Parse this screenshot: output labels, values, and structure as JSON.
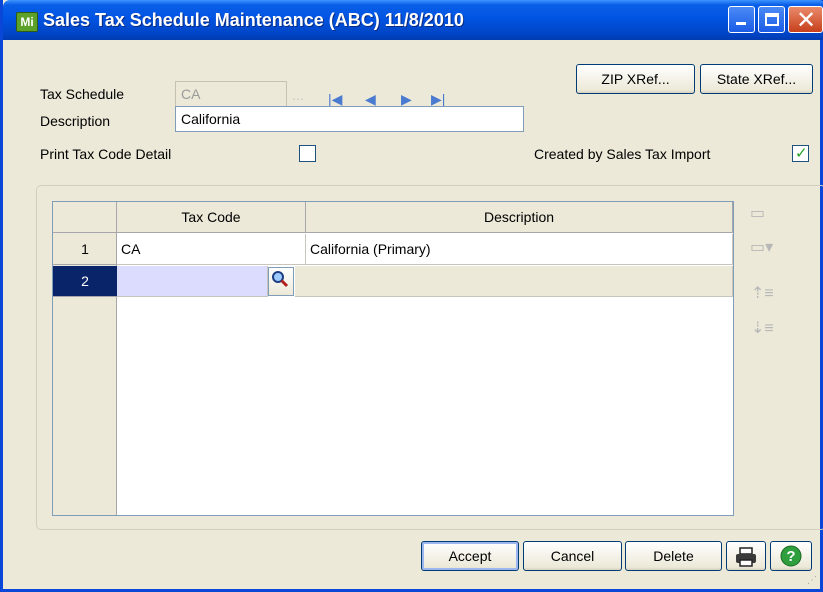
{
  "window": {
    "title": "Sales Tax Schedule Maintenance (ABC) 11/8/2010",
    "app_icon": "Mi"
  },
  "header": {
    "tax_schedule_label": "Tax Schedule",
    "tax_schedule_value": "CA",
    "description_label": "Description",
    "description_value": "California",
    "print_detail_label": "Print Tax Code Detail",
    "print_detail_checked": false,
    "created_by_import_label": "Created by Sales Tax Import",
    "created_by_import_checked": true,
    "zip_xref_label": "ZIP XRef...",
    "state_xref_label": "State XRef..."
  },
  "grid": {
    "columns": [
      "Tax Code",
      "Description"
    ],
    "rows": [
      {
        "num": "1",
        "tax_code": "CA",
        "description": "California (Primary)"
      },
      {
        "num": "2",
        "tax_code": "",
        "description": ""
      }
    ]
  },
  "footer": {
    "accept_label": "Accept",
    "cancel_label": "Cancel",
    "delete_label": "Delete"
  },
  "icons": {
    "lookup": "magnifier-icon",
    "print": "printer-icon",
    "help": "help-icon"
  }
}
